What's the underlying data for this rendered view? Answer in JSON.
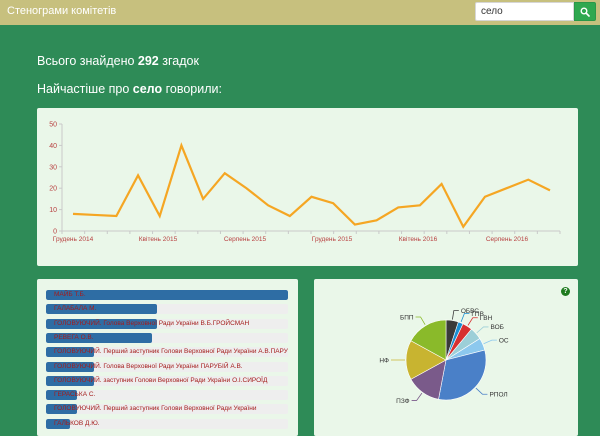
{
  "header": {
    "title": "Стенограми комітетів",
    "search_value": "село"
  },
  "summary": {
    "prefix": "Всього знайдено ",
    "count": "292",
    "suffix": " згадок"
  },
  "mostly": {
    "prefix": "Найчастіше про ",
    "term": "село",
    "suffix": " говорили:"
  },
  "timeline": {
    "color": "#f5a623",
    "chart_data": {
      "type": "line",
      "ylim": [
        0,
        50
      ],
      "yticks": [
        "0",
        "10",
        "20",
        "30",
        "40",
        "50"
      ],
      "xtick_labels": [
        "Грудень 2014",
        "Квітень 2015",
        "Серпень 2015",
        "Грудень 2015",
        "Квітень 2016",
        "Серпень 2016"
      ],
      "values": [
        8,
        7.5,
        7,
        26,
        7,
        40,
        15,
        27,
        20,
        12,
        7,
        16,
        13,
        3,
        5,
        11,
        12,
        22,
        2,
        16,
        20,
        24,
        19
      ]
    }
  },
  "speakers": {
    "items": [
      {
        "label": "МАЙБ Т.Б.",
        "fraction": 1.0
      },
      {
        "label": "ГАЛАБАЛА М.",
        "fraction": 0.46
      },
      {
        "label": "ГОЛОВУЮЧИЙ. Голова Верховної Ради України В.Б.ГРОЙСМАН",
        "fraction": 0.46
      },
      {
        "label": "РЕВЕГА О.В.",
        "fraction": 0.44
      },
      {
        "label": "ГОЛОВУЮЧИЙ. Перший заступник Голови Верховної Ради України А.В.ПАРУБІЙ",
        "fraction": 0.2
      },
      {
        "label": "ГОЛОВУЮЧИЙ. Голова Верховної Ради України ПАРУБІЙ А.В.",
        "fraction": 0.2
      },
      {
        "label": "ГОЛОВУЮЧИЙ. заступник Голови Верховної Ради України О.І.СИРОЇД",
        "fraction": 0.2
      },
      {
        "label": "ГЕРАСЬКА С.",
        "fraction": 0.13
      },
      {
        "label": "ГОЛОВУЮЧИЙ. Перший заступник Голови Верховної Ради України",
        "fraction": 0.13
      },
      {
        "label": "ГАЛЬКОВ Д.Ю.",
        "fraction": 0.1
      }
    ]
  },
  "parties": {
    "help_glyph": "?",
    "chart_data": {
      "type": "pie",
      "slices": [
        {
          "label": "ОБВС",
          "value": 5,
          "color": "#3a3a3a"
        },
        {
          "label": "ГПВ",
          "value": 2,
          "color": "#1a8fd1"
        },
        {
          "label": "ГВН",
          "value": 4,
          "color": "#d73030"
        },
        {
          "label": "ВОБ",
          "value": 5,
          "color": "#9ccfd8"
        },
        {
          "label": "ОС",
          "value": 5,
          "color": "#8cc8ee"
        },
        {
          "label": "РПОЛ",
          "value": 32,
          "color": "#4a80c8"
        },
        {
          "label": "ПЗФ",
          "value": 14,
          "color": "#7a5a8a"
        },
        {
          "label": "НФ",
          "value": 16,
          "color": "#c8b430"
        },
        {
          "label": "БПП",
          "value": 17,
          "color": "#8aba2a"
        }
      ]
    }
  }
}
